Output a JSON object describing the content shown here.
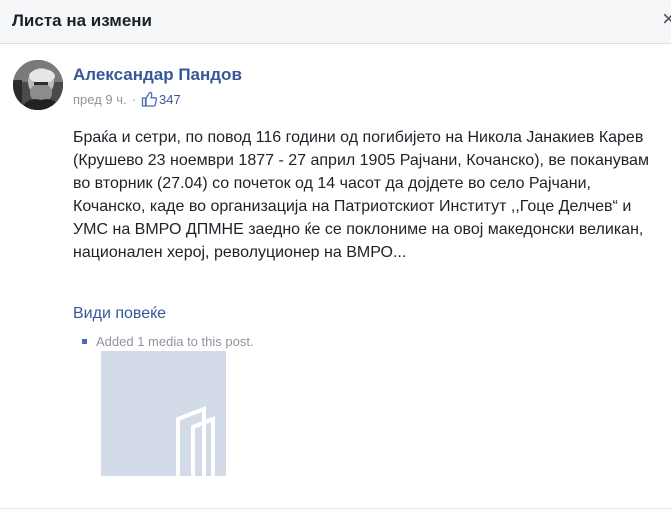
{
  "header": {
    "title": "Листа на измени",
    "close_icon": "close-icon"
  },
  "post": {
    "author": "Александар Пандов",
    "time": "пред 9 ч.",
    "separator": "·",
    "likes": "347",
    "like_icon": "thumbs-up-icon",
    "text": "Браќа и сетри, по повод 116 години од погибијето на Никола Јанакиев Карев (Крушево 23 ноември 1877 - 27 април 1905 Рајчани, Кочанско), ве поканувам во вторник (27.04) со почеток од 14 часот да дојдете во село Рајчани, Кочанско, каде во организација на Патриотскиот Институт ,,Гоце Делчев“ и УМС на ВМРО ДПМНЕ заедно ќе се поклониме на овој македонски великан, национален херој, револуционер на ВМРО...",
    "see_more": "Види повеќе",
    "activity": "Added 1 media to this post."
  },
  "colors": {
    "link": "#365899",
    "text": "#1d2129",
    "muted": "#90949c",
    "thumb_bg": "#d3dbe8"
  }
}
